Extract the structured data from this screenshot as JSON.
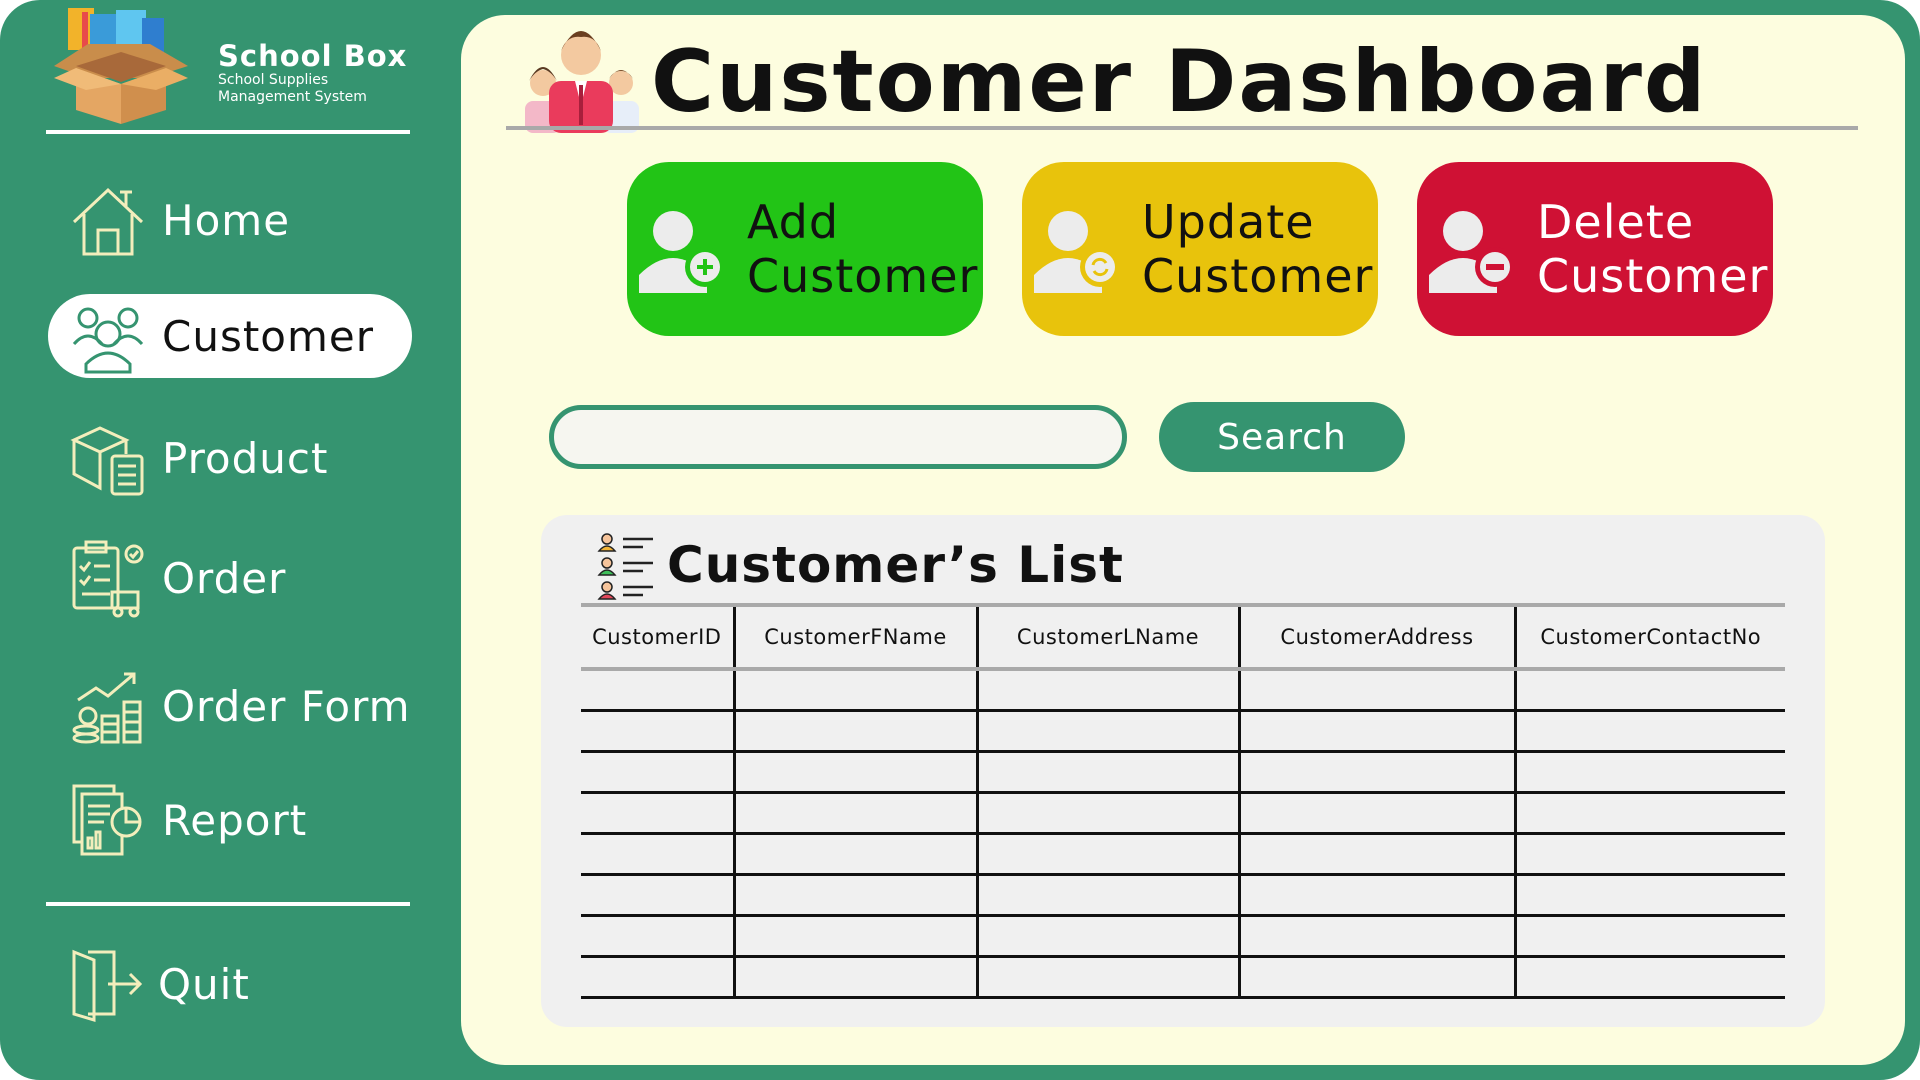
{
  "brand": {
    "title": "School Box",
    "subtitle_line1": "School Supplies",
    "subtitle_line2": "Management System"
  },
  "sidebar": {
    "items": [
      {
        "label": "Home",
        "icon": "home-icon",
        "active": false
      },
      {
        "label": "Customer",
        "icon": "customers-icon",
        "active": true
      },
      {
        "label": "Product",
        "icon": "product-box-icon",
        "active": false
      },
      {
        "label": "Order",
        "icon": "order-clipboard-icon",
        "active": false
      },
      {
        "label": "Order Form",
        "icon": "growth-coins-icon",
        "active": false
      },
      {
        "label": "Report",
        "icon": "report-icon",
        "active": false
      }
    ],
    "quit_label": "Quit"
  },
  "header": {
    "title": "Customer Dashboard"
  },
  "actions": {
    "add": {
      "line1": "Add",
      "line2": "Customer",
      "color": "#22c416"
    },
    "update": {
      "line1": "Update",
      "line2": "Customer",
      "color": "#e8c30c"
    },
    "delete": {
      "line1": "Delete",
      "line2": "Customer",
      "color": "#cf1134"
    }
  },
  "search": {
    "value": "",
    "button_label": "Search"
  },
  "customer_list": {
    "title": "Customer’s List",
    "columns": [
      "CustomerID",
      "CustomerFName",
      "CustomerLName",
      "CustomerAddress",
      "CustomerContactNo"
    ],
    "empty_row_count": 8
  },
  "colors": {
    "sidebar": "#359470",
    "panel": "#fdfddf",
    "accent": "#359470"
  }
}
